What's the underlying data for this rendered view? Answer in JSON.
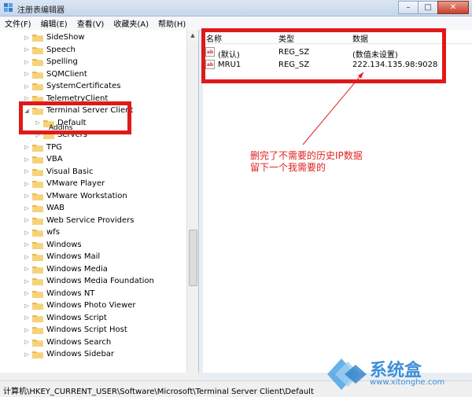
{
  "window": {
    "title": "注册表编辑器"
  },
  "menu": [
    "文件(F)",
    "编辑(E)",
    "查看(V)",
    "收藏夹(A)",
    "帮助(H)"
  ],
  "tree": [
    {
      "label": "SideShow",
      "depth": 0
    },
    {
      "label": "Speech",
      "depth": 0
    },
    {
      "label": "Spelling",
      "depth": 0
    },
    {
      "label": "SQMClient",
      "depth": 0
    },
    {
      "label": "SystemCertificates",
      "depth": 0
    },
    {
      "label": "TelemetryClient",
      "depth": 0
    },
    {
      "label": "Terminal Server Client",
      "depth": 0,
      "expanded": true
    },
    {
      "label": "Default",
      "depth": 1,
      "selected": true
    },
    {
      "label": "Servers",
      "depth": 1
    },
    {
      "label": "TPG",
      "depth": 0
    },
    {
      "label": "VBA",
      "depth": 0
    },
    {
      "label": "Visual Basic",
      "depth": 0
    },
    {
      "label": "VMware Player",
      "depth": 0
    },
    {
      "label": "VMware Workstation",
      "depth": 0
    },
    {
      "label": "WAB",
      "depth": 0
    },
    {
      "label": "Web Service Providers",
      "depth": 0
    },
    {
      "label": "wfs",
      "depth": 0
    },
    {
      "label": "Windows",
      "depth": 0
    },
    {
      "label": "Windows Mail",
      "depth": 0
    },
    {
      "label": "Windows Media",
      "depth": 0
    },
    {
      "label": "Windows Media Foundation",
      "depth": 0
    },
    {
      "label": "Windows NT",
      "depth": 0
    },
    {
      "label": "Windows Photo Viewer",
      "depth": 0
    },
    {
      "label": "Windows Script",
      "depth": 0
    },
    {
      "label": "Windows Script Host",
      "depth": 0
    },
    {
      "label": "Windows Search",
      "depth": 0
    },
    {
      "label": "Windows Sidebar",
      "depth": 0
    }
  ],
  "partial_tree_label": "AddIns",
  "list": {
    "columns": [
      "名称",
      "类型",
      "数据"
    ],
    "rows": [
      {
        "name": "(默认)",
        "type": "REG_SZ",
        "data": "(数值未设置)"
      },
      {
        "name": "MRU1",
        "type": "REG_SZ",
        "data": "222.134.135.98:9028"
      }
    ]
  },
  "annotation": [
    "删完了不需要的历史IP数据",
    "留下一个我需要的"
  ],
  "status": "计算机\\HKEY_CURRENT_USER\\Software\\Microsoft\\Terminal Server Client\\Default",
  "watermark": {
    "brand": "系统盒",
    "url": "www.xitonghe.com"
  },
  "colors": {
    "annotation_red": "#e01919",
    "folder": "#f1c75b",
    "watermark_blue": "#3d8fd7"
  }
}
